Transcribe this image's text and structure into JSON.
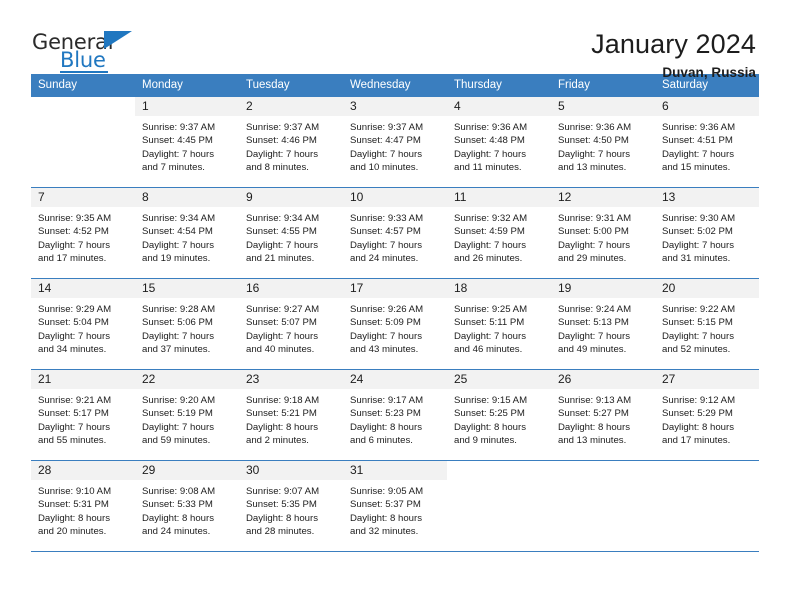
{
  "brand": {
    "name_top": "General",
    "name_bottom": "Blue",
    "triangle_color": "#2077c0"
  },
  "header": {
    "title": "January 2024",
    "location": "Duvan, Russia"
  },
  "theme": {
    "header_blue": "#3a7ebf",
    "daynum_band": "#f2f2f2",
    "text": "#1d1d1d"
  },
  "columns": [
    "Sunday",
    "Monday",
    "Tuesday",
    "Wednesday",
    "Thursday",
    "Friday",
    "Saturday"
  ],
  "weeks": [
    [
      {
        "day": "",
        "sunrise": "",
        "sunset": "",
        "daylight_1": "",
        "daylight_2": ""
      },
      {
        "day": "1",
        "sunrise": "Sunrise: 9:37 AM",
        "sunset": "Sunset: 4:45 PM",
        "daylight_1": "Daylight: 7 hours",
        "daylight_2": "and 7 minutes."
      },
      {
        "day": "2",
        "sunrise": "Sunrise: 9:37 AM",
        "sunset": "Sunset: 4:46 PM",
        "daylight_1": "Daylight: 7 hours",
        "daylight_2": "and 8 minutes."
      },
      {
        "day": "3",
        "sunrise": "Sunrise: 9:37 AM",
        "sunset": "Sunset: 4:47 PM",
        "daylight_1": "Daylight: 7 hours",
        "daylight_2": "and 10 minutes."
      },
      {
        "day": "4",
        "sunrise": "Sunrise: 9:36 AM",
        "sunset": "Sunset: 4:48 PM",
        "daylight_1": "Daylight: 7 hours",
        "daylight_2": "and 11 minutes."
      },
      {
        "day": "5",
        "sunrise": "Sunrise: 9:36 AM",
        "sunset": "Sunset: 4:50 PM",
        "daylight_1": "Daylight: 7 hours",
        "daylight_2": "and 13 minutes."
      },
      {
        "day": "6",
        "sunrise": "Sunrise: 9:36 AM",
        "sunset": "Sunset: 4:51 PM",
        "daylight_1": "Daylight: 7 hours",
        "daylight_2": "and 15 minutes."
      }
    ],
    [
      {
        "day": "7",
        "sunrise": "Sunrise: 9:35 AM",
        "sunset": "Sunset: 4:52 PM",
        "daylight_1": "Daylight: 7 hours",
        "daylight_2": "and 17 minutes."
      },
      {
        "day": "8",
        "sunrise": "Sunrise: 9:34 AM",
        "sunset": "Sunset: 4:54 PM",
        "daylight_1": "Daylight: 7 hours",
        "daylight_2": "and 19 minutes."
      },
      {
        "day": "9",
        "sunrise": "Sunrise: 9:34 AM",
        "sunset": "Sunset: 4:55 PM",
        "daylight_1": "Daylight: 7 hours",
        "daylight_2": "and 21 minutes."
      },
      {
        "day": "10",
        "sunrise": "Sunrise: 9:33 AM",
        "sunset": "Sunset: 4:57 PM",
        "daylight_1": "Daylight: 7 hours",
        "daylight_2": "and 24 minutes."
      },
      {
        "day": "11",
        "sunrise": "Sunrise: 9:32 AM",
        "sunset": "Sunset: 4:59 PM",
        "daylight_1": "Daylight: 7 hours",
        "daylight_2": "and 26 minutes."
      },
      {
        "day": "12",
        "sunrise": "Sunrise: 9:31 AM",
        "sunset": "Sunset: 5:00 PM",
        "daylight_1": "Daylight: 7 hours",
        "daylight_2": "and 29 minutes."
      },
      {
        "day": "13",
        "sunrise": "Sunrise: 9:30 AM",
        "sunset": "Sunset: 5:02 PM",
        "daylight_1": "Daylight: 7 hours",
        "daylight_2": "and 31 minutes."
      }
    ],
    [
      {
        "day": "14",
        "sunrise": "Sunrise: 9:29 AM",
        "sunset": "Sunset: 5:04 PM",
        "daylight_1": "Daylight: 7 hours",
        "daylight_2": "and 34 minutes."
      },
      {
        "day": "15",
        "sunrise": "Sunrise: 9:28 AM",
        "sunset": "Sunset: 5:06 PM",
        "daylight_1": "Daylight: 7 hours",
        "daylight_2": "and 37 minutes."
      },
      {
        "day": "16",
        "sunrise": "Sunrise: 9:27 AM",
        "sunset": "Sunset: 5:07 PM",
        "daylight_1": "Daylight: 7 hours",
        "daylight_2": "and 40 minutes."
      },
      {
        "day": "17",
        "sunrise": "Sunrise: 9:26 AM",
        "sunset": "Sunset: 5:09 PM",
        "daylight_1": "Daylight: 7 hours",
        "daylight_2": "and 43 minutes."
      },
      {
        "day": "18",
        "sunrise": "Sunrise: 9:25 AM",
        "sunset": "Sunset: 5:11 PM",
        "daylight_1": "Daylight: 7 hours",
        "daylight_2": "and 46 minutes."
      },
      {
        "day": "19",
        "sunrise": "Sunrise: 9:24 AM",
        "sunset": "Sunset: 5:13 PM",
        "daylight_1": "Daylight: 7 hours",
        "daylight_2": "and 49 minutes."
      },
      {
        "day": "20",
        "sunrise": "Sunrise: 9:22 AM",
        "sunset": "Sunset: 5:15 PM",
        "daylight_1": "Daylight: 7 hours",
        "daylight_2": "and 52 minutes."
      }
    ],
    [
      {
        "day": "21",
        "sunrise": "Sunrise: 9:21 AM",
        "sunset": "Sunset: 5:17 PM",
        "daylight_1": "Daylight: 7 hours",
        "daylight_2": "and 55 minutes."
      },
      {
        "day": "22",
        "sunrise": "Sunrise: 9:20 AM",
        "sunset": "Sunset: 5:19 PM",
        "daylight_1": "Daylight: 7 hours",
        "daylight_2": "and 59 minutes."
      },
      {
        "day": "23",
        "sunrise": "Sunrise: 9:18 AM",
        "sunset": "Sunset: 5:21 PM",
        "daylight_1": "Daylight: 8 hours",
        "daylight_2": "and 2 minutes."
      },
      {
        "day": "24",
        "sunrise": "Sunrise: 9:17 AM",
        "sunset": "Sunset: 5:23 PM",
        "daylight_1": "Daylight: 8 hours",
        "daylight_2": "and 6 minutes."
      },
      {
        "day": "25",
        "sunrise": "Sunrise: 9:15 AM",
        "sunset": "Sunset: 5:25 PM",
        "daylight_1": "Daylight: 8 hours",
        "daylight_2": "and 9 minutes."
      },
      {
        "day": "26",
        "sunrise": "Sunrise: 9:13 AM",
        "sunset": "Sunset: 5:27 PM",
        "daylight_1": "Daylight: 8 hours",
        "daylight_2": "and 13 minutes."
      },
      {
        "day": "27",
        "sunrise": "Sunrise: 9:12 AM",
        "sunset": "Sunset: 5:29 PM",
        "daylight_1": "Daylight: 8 hours",
        "daylight_2": "and 17 minutes."
      }
    ],
    [
      {
        "day": "28",
        "sunrise": "Sunrise: 9:10 AM",
        "sunset": "Sunset: 5:31 PM",
        "daylight_1": "Daylight: 8 hours",
        "daylight_2": "and 20 minutes."
      },
      {
        "day": "29",
        "sunrise": "Sunrise: 9:08 AM",
        "sunset": "Sunset: 5:33 PM",
        "daylight_1": "Daylight: 8 hours",
        "daylight_2": "and 24 minutes."
      },
      {
        "day": "30",
        "sunrise": "Sunrise: 9:07 AM",
        "sunset": "Sunset: 5:35 PM",
        "daylight_1": "Daylight: 8 hours",
        "daylight_2": "and 28 minutes."
      },
      {
        "day": "31",
        "sunrise": "Sunrise: 9:05 AM",
        "sunset": "Sunset: 5:37 PM",
        "daylight_1": "Daylight: 8 hours",
        "daylight_2": "and 32 minutes."
      },
      {
        "day": "",
        "sunrise": "",
        "sunset": "",
        "daylight_1": "",
        "daylight_2": ""
      },
      {
        "day": "",
        "sunrise": "",
        "sunset": "",
        "daylight_1": "",
        "daylight_2": ""
      },
      {
        "day": "",
        "sunrise": "",
        "sunset": "",
        "daylight_1": "",
        "daylight_2": ""
      }
    ]
  ]
}
